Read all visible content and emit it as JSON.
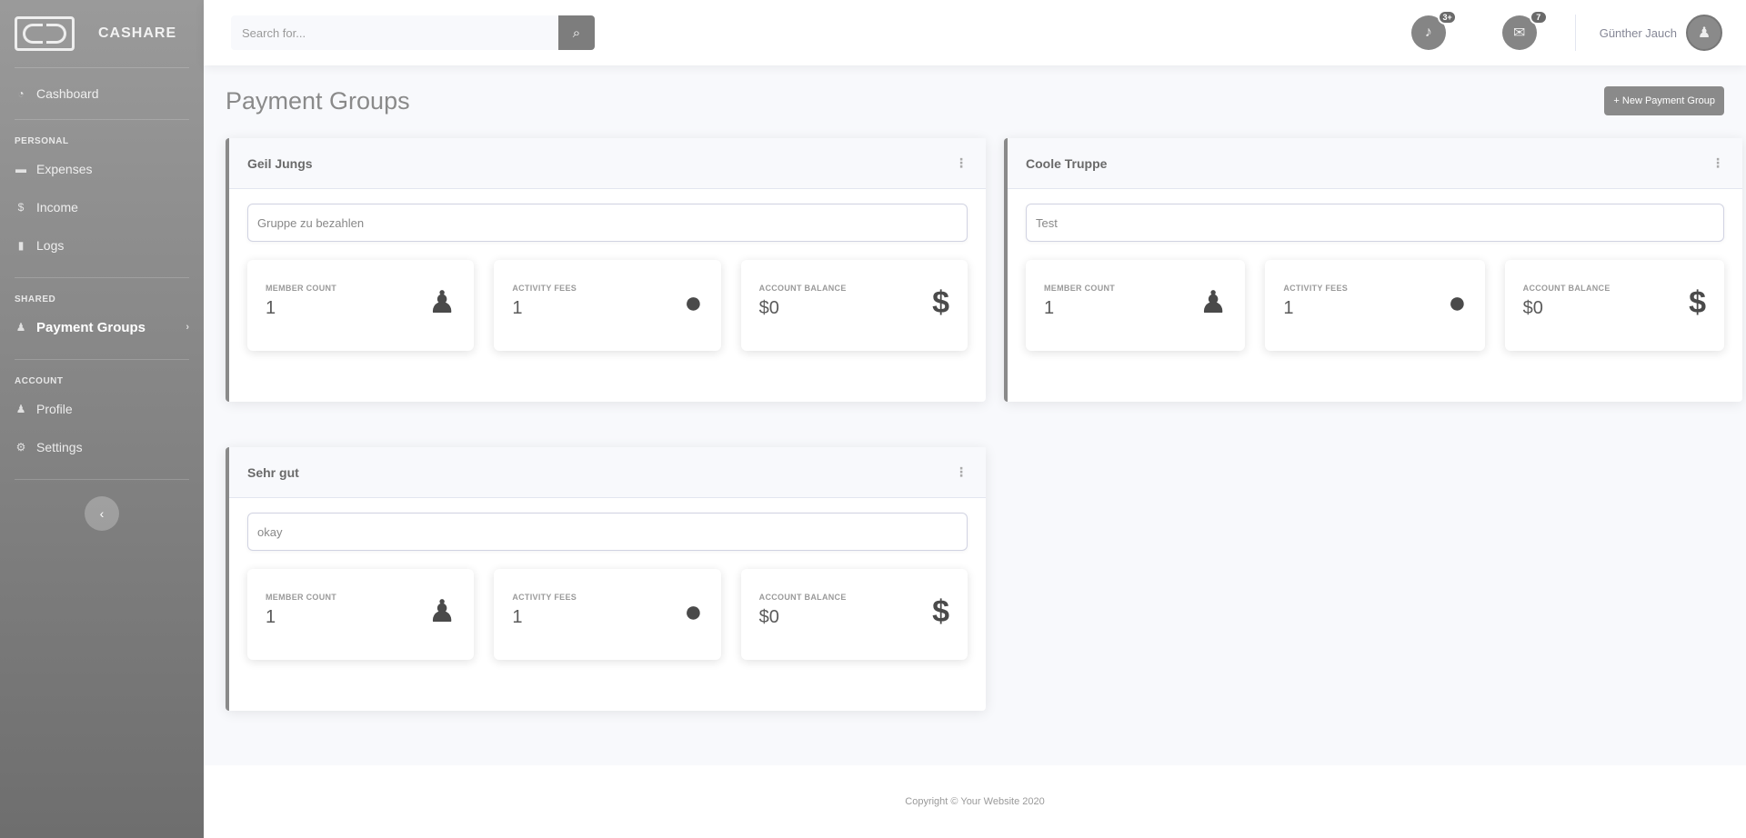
{
  "brand": {
    "name": "CASHARE"
  },
  "sidebar": {
    "dashboard": {
      "label": "Cashboard",
      "icon": "tachometer-icon"
    },
    "sections": [
      {
        "heading": "Personal",
        "items": [
          {
            "label": "Expenses",
            "icon": "money-bill-icon"
          },
          {
            "label": "Income",
            "icon": "dollar-icon"
          },
          {
            "label": "Logs",
            "icon": "file-icon"
          }
        ]
      },
      {
        "heading": "Shared",
        "items": [
          {
            "label": "Payment Groups",
            "icon": "users-icon",
            "active": true
          }
        ]
      },
      {
        "heading": "Account",
        "items": [
          {
            "label": "Profile",
            "icon": "user-icon"
          },
          {
            "label": "Settings",
            "icon": "cog-icon"
          }
        ]
      }
    ]
  },
  "topbar": {
    "search_placeholder": "Search for...",
    "alerts_count": "3+",
    "messages_count": "7",
    "user_name": "Günther Jauch"
  },
  "page": {
    "title": "Payment Groups",
    "new_button": "+ New Payment Group"
  },
  "groups": [
    {
      "name": "Geil Jungs",
      "description": "Gruppe zu bezahlen",
      "member_label": "Member count",
      "member_value": "1",
      "fees_label": "Activity fees",
      "fees_value": "1",
      "balance_label": "Account balance",
      "balance_value": "$0"
    },
    {
      "name": "Coole Truppe",
      "description": "Test",
      "member_label": "Member count",
      "member_value": "1",
      "fees_label": "Activity fees",
      "fees_value": "1",
      "balance_label": "Account balance",
      "balance_value": "$0"
    },
    {
      "name": "Sehr gut",
      "description": "okay",
      "member_label": "Member count",
      "member_value": "1",
      "fees_label": "Activity fees",
      "fees_value": "1",
      "balance_label": "Account balance",
      "balance_value": "$0"
    }
  ],
  "footer": {
    "text": "Copyright © Your Website 2020"
  }
}
